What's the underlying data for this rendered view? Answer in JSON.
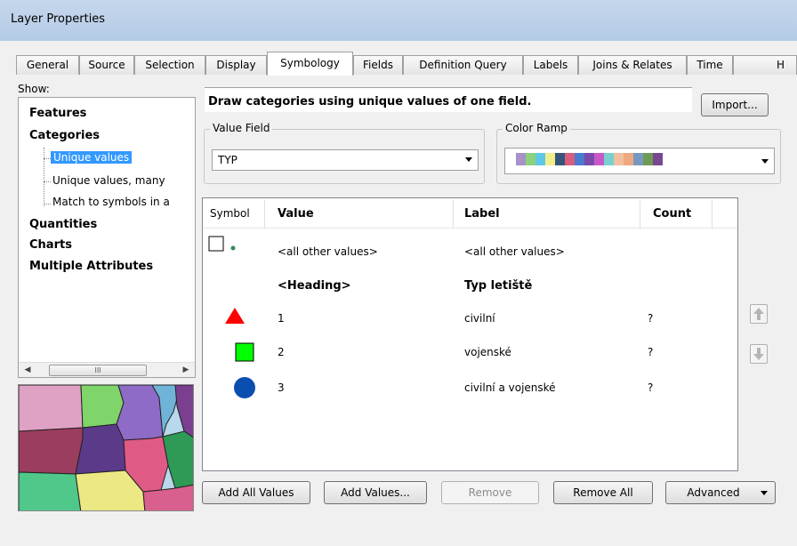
{
  "window": {
    "title": "Layer Properties"
  },
  "tabs": [
    {
      "label": "General"
    },
    {
      "label": "Source"
    },
    {
      "label": "Selection"
    },
    {
      "label": "Display"
    },
    {
      "label": "Symbology"
    },
    {
      "label": "Fields"
    },
    {
      "label": "Definition Query"
    },
    {
      "label": "Labels"
    },
    {
      "label": "Joins & Relates"
    },
    {
      "label": "Time"
    },
    {
      "label": "H"
    }
  ],
  "active_tab": "Symbology",
  "show_panel": {
    "label": "Show:",
    "items": {
      "features": "Features",
      "categories": "Categories",
      "unique_values": "Unique values",
      "unique_values_many": "Unique values, many",
      "match_to_symbols": "Match to symbols in a",
      "quantities": "Quantities",
      "charts": "Charts",
      "multiple_attributes": "Multiple Attributes"
    },
    "selected": "Unique values",
    "scroll_thumb_glyph": "III"
  },
  "description": "Draw categories using unique values of one field.",
  "import_button": "Import...",
  "value_field": {
    "label": "Value Field",
    "value": "TYP"
  },
  "color_ramp": {
    "label": "Color Ramp",
    "colors": [
      "#a890c8",
      "#8ed17c",
      "#5dc8e8",
      "#f2ee8a",
      "#34557a",
      "#d85c7c",
      "#4a7ad0",
      "#7a4aa8",
      "#c858c8",
      "#78d0d0",
      "#f2c0a0",
      "#f0a880",
      "#7898c0",
      "#6e9a58",
      "#7a4890"
    ]
  },
  "grid": {
    "headers": {
      "symbol": "Symbol",
      "value": "Value",
      "label": "Label",
      "count": "Count"
    },
    "rows": [
      {
        "value": "<all other values>",
        "label": "<all other values>",
        "count": ""
      },
      {
        "value": "<Heading>",
        "label": "Typ letiště",
        "count": ""
      },
      {
        "value": "1",
        "label": "civilní",
        "count": "?"
      },
      {
        "value": "2",
        "label": "vojenské",
        "count": "?"
      },
      {
        "value": "3",
        "label": "civilní a vojenské",
        "count": "?"
      }
    ],
    "symbol_colors": {
      "triangle": "#ff0000",
      "square": "#00ff00",
      "circle": "#0a4fb0",
      "other_dot": "#2e8b57"
    }
  },
  "buttons": {
    "add_all_values": "Add All Values",
    "add_values": "Add Values...",
    "remove": "Remove",
    "remove_all": "Remove All",
    "advanced": "Advanced"
  }
}
